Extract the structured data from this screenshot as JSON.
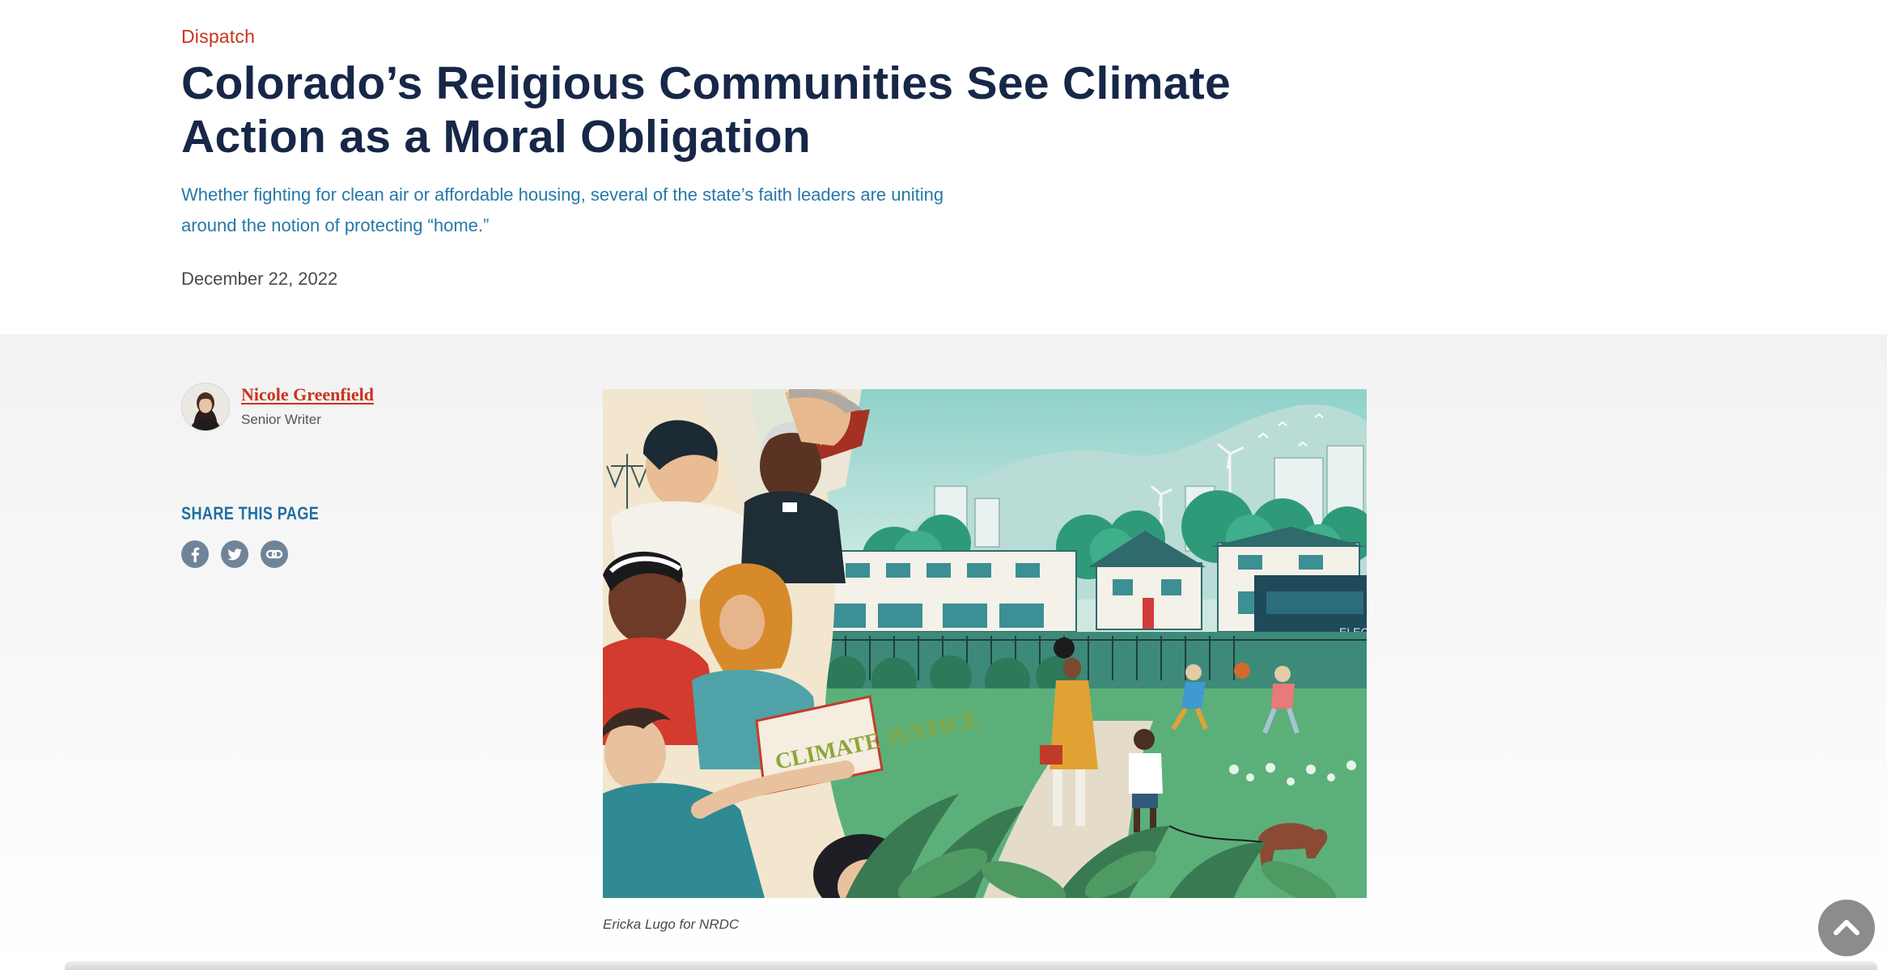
{
  "article": {
    "category": "Dispatch",
    "title": "Colorado’s Religious Communities See Climate Action as a Moral Obligation",
    "subtitle": "Whether fighting for clean air or affordable housing, several of the state’s faith leaders are uniting around the notion of protecting “home.”",
    "date": "December 22, 2022"
  },
  "author": {
    "name": "Nicole Greenfield",
    "role": "Senior Writer"
  },
  "share": {
    "heading": "SHARE THIS PAGE",
    "icons": [
      "facebook-icon",
      "twitter-icon",
      "link-icon"
    ]
  },
  "image": {
    "sign_text": "CLIMATE JUSTICE",
    "bus_text": "ELEC",
    "caption": "Ericka Lugo for NRDC"
  },
  "colors": {
    "title": "#162748",
    "category": "#c8331b",
    "subtitle": "#2678a8",
    "share_heading": "#1f6fa2",
    "share_icon": "#6f8499",
    "author_link": "#c8331b"
  },
  "controls": {
    "scroll_top_icon": "chevron-up-icon"
  }
}
